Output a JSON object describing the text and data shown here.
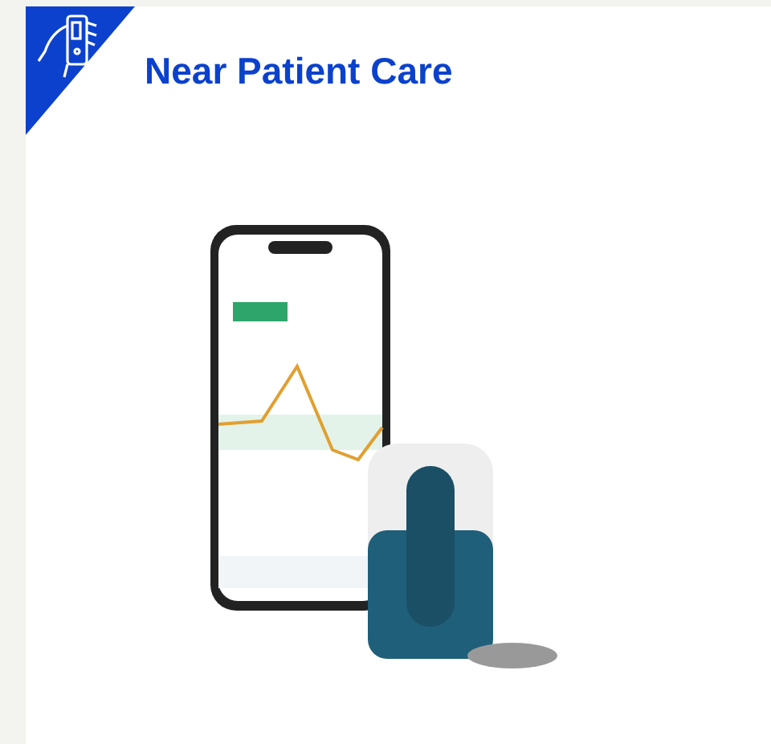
{
  "card": {
    "title": "Near Patient Care"
  }
}
